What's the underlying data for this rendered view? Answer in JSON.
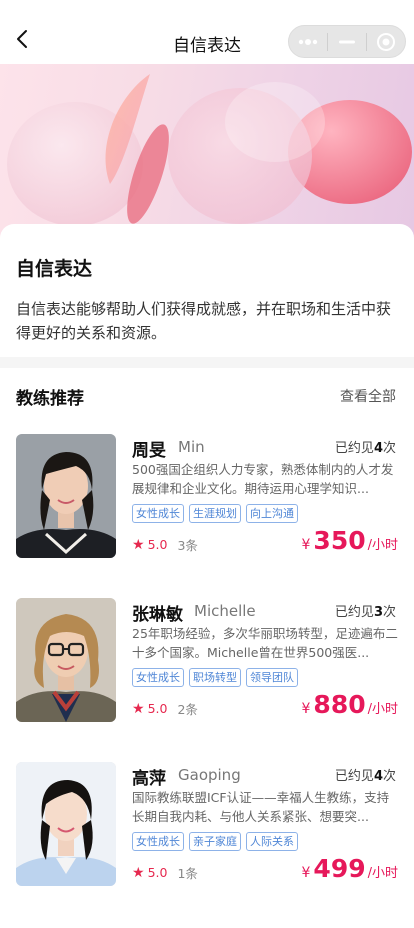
{
  "nav": {
    "title": "自信表达"
  },
  "intro": {
    "title": "自信表达",
    "description": "自信表达能够帮助人们获得成就感，并在职场和生活中获得更好的关系和资源。"
  },
  "section": {
    "title": "教练推荐",
    "more_label": "查看全部"
  },
  "coaches": [
    {
      "name": "周旻",
      "english_name": "Min",
      "seen_prefix": "已约见",
      "seen_count": "4",
      "seen_suffix": "次",
      "description": "500强国企组织人力专家，熟悉体制内的人才发展规律和企业文化。期待运用心理学知识...",
      "tags": [
        "女性成长",
        "生涯规划",
        "向上沟通"
      ],
      "rating": "5.0",
      "review_count": "3条",
      "currency": "¥",
      "price": "350",
      "unit": "/小时"
    },
    {
      "name": "张琳敏",
      "english_name": "Michelle",
      "seen_prefix": "已约见",
      "seen_count": "3",
      "seen_suffix": "次",
      "description": "25年职场经验，多次华丽职场转型，足迹遍布二十多个国家。Michelle曾在世界500强医...",
      "tags": [
        "女性成长",
        "职场转型",
        "领导团队"
      ],
      "rating": "5.0",
      "review_count": "2条",
      "currency": "¥",
      "price": "880",
      "unit": "/小时"
    },
    {
      "name": "高萍",
      "english_name": "Gaoping",
      "seen_prefix": "已约见",
      "seen_count": "4",
      "seen_suffix": "次",
      "description": "国际教练联盟ICF认证——幸福人生教练，支持长期自我内耗、与他人关系紧张、想要突...",
      "tags": [
        "女性成长",
        "亲子家庭",
        "人际关系"
      ],
      "rating": "5.0",
      "review_count": "1条",
      "currency": "¥",
      "price": "499",
      "unit": "/小时"
    }
  ],
  "colors": {
    "accent": "#e6185a",
    "tag": "#4f86d6"
  }
}
